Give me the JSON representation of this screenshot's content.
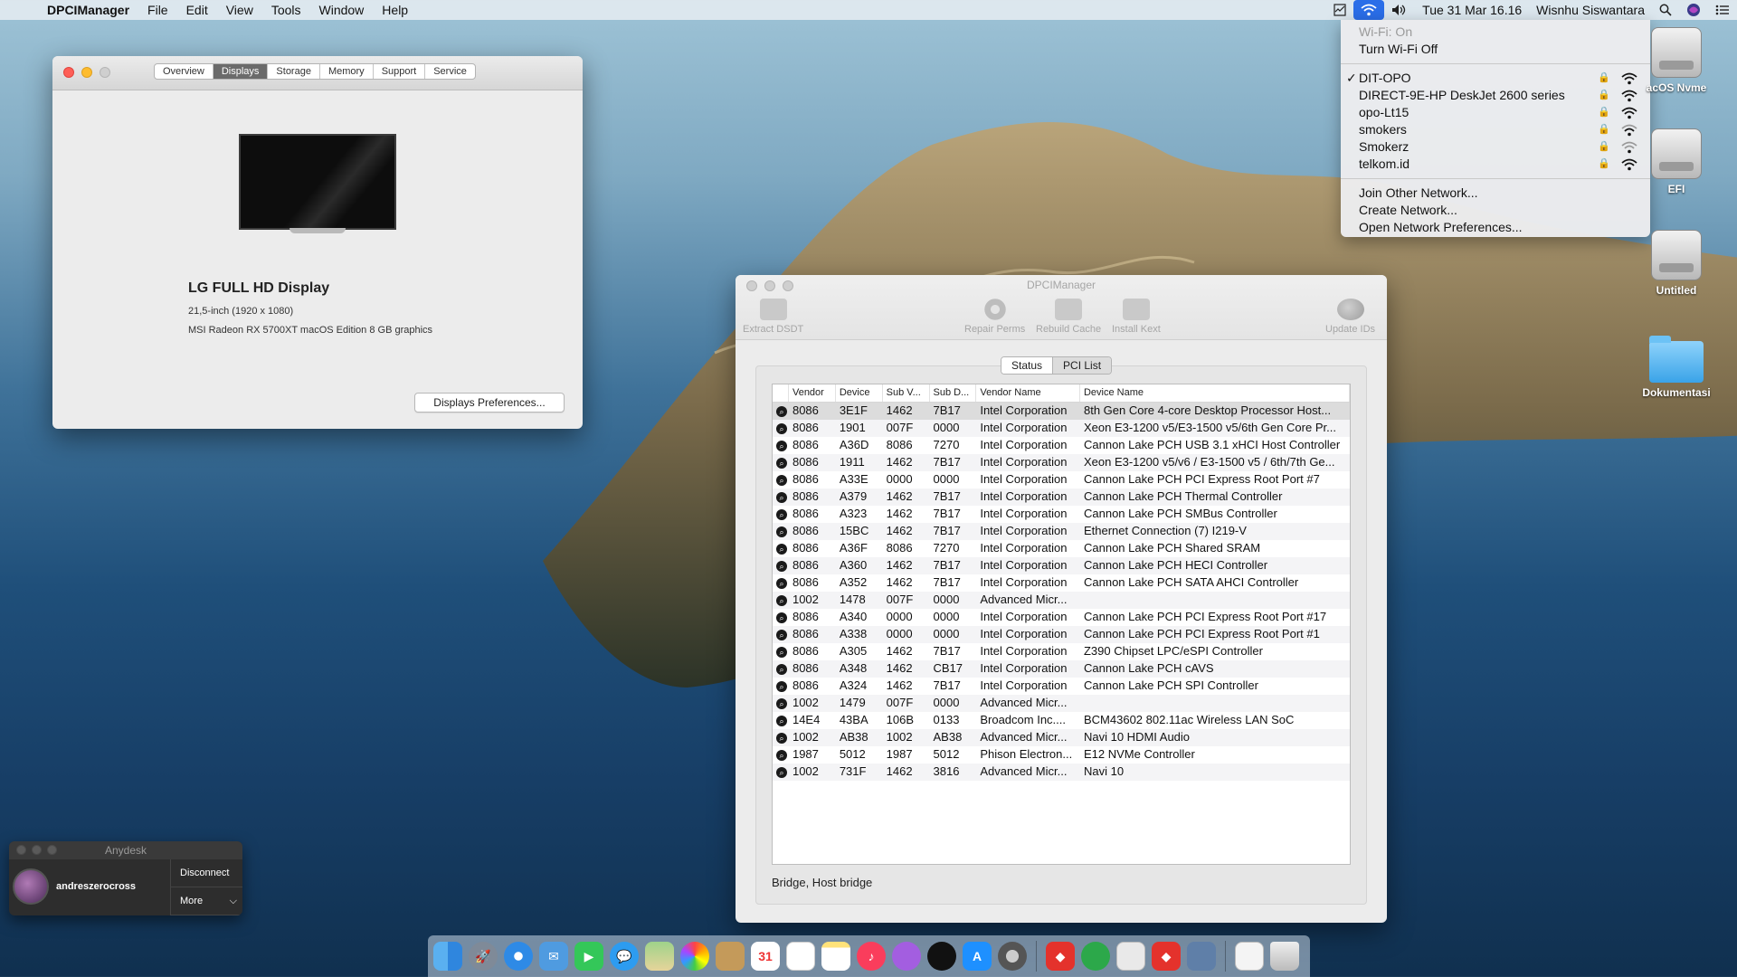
{
  "menubar": {
    "app": "DPCIManager",
    "items": [
      "File",
      "Edit",
      "View",
      "Tools",
      "Window",
      "Help"
    ],
    "clock": "Tue 31 Mar  16.16",
    "user": "Wisnhu Siswantara"
  },
  "wifi_menu": {
    "status": "Wi-Fi: On",
    "toggle": "Turn Wi-Fi Off",
    "networks": [
      {
        "name": "DIT-OPO",
        "connected": true
      },
      {
        "name": "DIRECT-9E-HP DeskJet 2600 series",
        "connected": false
      },
      {
        "name": "opo-Lt15",
        "connected": false
      },
      {
        "name": "smokers",
        "connected": false
      },
      {
        "name": "Smokerz",
        "connected": false
      },
      {
        "name": "telkom.id",
        "connected": false
      }
    ],
    "actions": [
      "Join Other Network...",
      "Create Network...",
      "Open Network Preferences..."
    ],
    "checkmark": "✓"
  },
  "desktop": {
    "icons": [
      "acOS Nvme",
      "EFI",
      "Untitled",
      "Dokumentasi"
    ]
  },
  "about": {
    "tabs": [
      "Overview",
      "Displays",
      "Storage",
      "Memory",
      "Support",
      "Service"
    ],
    "active_tab": "Displays",
    "display_name": "LG FULL HD Display",
    "size": "21,5-inch (1920 x 1080)",
    "graphics": "MSI Radeon RX 5700XT macOS Edition 8 GB graphics",
    "prefs_button": "Displays Preferences..."
  },
  "dpci": {
    "title": "DPCIManager",
    "toolbar": [
      "Extract DSDT",
      "Repair Perms",
      "Rebuild Cache",
      "Install Kext",
      "Update IDs"
    ],
    "tabs": [
      "Status",
      "PCI List"
    ],
    "columns": [
      "",
      "Vendor",
      "Device",
      "Sub V...",
      "Sub D...",
      "Vendor Name",
      "Device Name"
    ],
    "rows": [
      [
        "8086",
        "3E1F",
        "1462",
        "7B17",
        "Intel Corporation",
        "8th Gen Core 4-core Desktop Processor Host..."
      ],
      [
        "8086",
        "1901",
        "007F",
        "0000",
        "Intel Corporation",
        "Xeon E3-1200 v5/E3-1500 v5/6th Gen Core Pr..."
      ],
      [
        "8086",
        "A36D",
        "8086",
        "7270",
        "Intel Corporation",
        "Cannon Lake PCH USB 3.1 xHCI Host Controller"
      ],
      [
        "8086",
        "1911",
        "1462",
        "7B17",
        "Intel Corporation",
        "Xeon E3-1200 v5/v6 / E3-1500 v5 / 6th/7th Ge..."
      ],
      [
        "8086",
        "A33E",
        "0000",
        "0000",
        "Intel Corporation",
        "Cannon Lake PCH PCI Express Root Port #7"
      ],
      [
        "8086",
        "A379",
        "1462",
        "7B17",
        "Intel Corporation",
        "Cannon Lake PCH Thermal Controller"
      ],
      [
        "8086",
        "A323",
        "1462",
        "7B17",
        "Intel Corporation",
        "Cannon Lake PCH SMBus Controller"
      ],
      [
        "8086",
        "15BC",
        "1462",
        "7B17",
        "Intel Corporation",
        "Ethernet Connection (7) I219-V"
      ],
      [
        "8086",
        "A36F",
        "8086",
        "7270",
        "Intel Corporation",
        "Cannon Lake PCH Shared SRAM"
      ],
      [
        "8086",
        "A360",
        "1462",
        "7B17",
        "Intel Corporation",
        "Cannon Lake PCH HECI Controller"
      ],
      [
        "8086",
        "A352",
        "1462",
        "7B17",
        "Intel Corporation",
        "Cannon Lake PCH SATA AHCI Controller"
      ],
      [
        "1002",
        "1478",
        "007F",
        "0000",
        "Advanced Micr...",
        ""
      ],
      [
        "8086",
        "A340",
        "0000",
        "0000",
        "Intel Corporation",
        "Cannon Lake PCH PCI Express Root Port #17"
      ],
      [
        "8086",
        "A338",
        "0000",
        "0000",
        "Intel Corporation",
        "Cannon Lake PCH PCI Express Root Port #1"
      ],
      [
        "8086",
        "A305",
        "1462",
        "7B17",
        "Intel Corporation",
        "Z390 Chipset LPC/eSPI Controller"
      ],
      [
        "8086",
        "A348",
        "1462",
        "CB17",
        "Intel Corporation",
        "Cannon Lake PCH cAVS"
      ],
      [
        "8086",
        "A324",
        "1462",
        "7B17",
        "Intel Corporation",
        "Cannon Lake PCH SPI Controller"
      ],
      [
        "1002",
        "1479",
        "007F",
        "0000",
        "Advanced Micr...",
        ""
      ],
      [
        "14E4",
        "43BA",
        "106B",
        "0133",
        "Broadcom Inc....",
        "BCM43602 802.11ac Wireless LAN SoC"
      ],
      [
        "1002",
        "AB38",
        "1002",
        "AB38",
        "Advanced Micr...",
        "Navi 10 HDMI Audio"
      ],
      [
        "1987",
        "5012",
        "1987",
        "5012",
        "Phison Electron...",
        "E12 NVMe Controller"
      ],
      [
        "1002",
        "731F",
        "1462",
        "3816",
        "Advanced Micr...",
        "Navi 10"
      ]
    ],
    "status_text": "Bridge, Host bridge"
  },
  "anydesk": {
    "title": "Anydesk",
    "user": "andreszerocross",
    "disconnect": "Disconnect",
    "more": "More"
  },
  "dock": {
    "calendar_day": "31"
  }
}
